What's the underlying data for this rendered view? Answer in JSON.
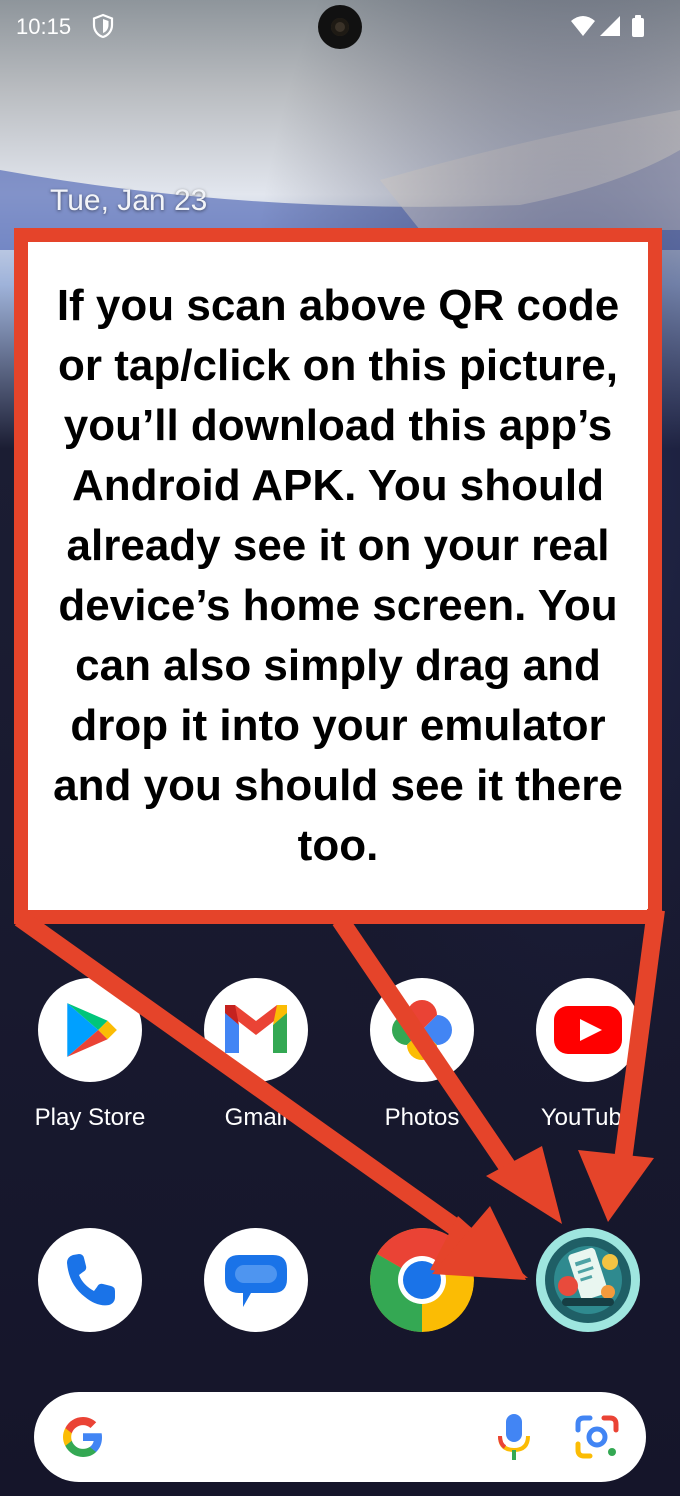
{
  "status_bar": {
    "time": "10:15",
    "icons": [
      "shield-icon",
      "wifi-icon",
      "signal-icon",
      "battery-icon"
    ]
  },
  "home": {
    "date": "Tue, Jan 23"
  },
  "callout": {
    "text": "If you scan above QR code or tap/click on this picture, you’ll download this app’s Android APK. You should already see it on your real device’s home screen. You can also simply drag and drop it into your emulator and you should see it there too.",
    "border_color": "#e5442a"
  },
  "apps_row1": [
    {
      "label": "Play Store",
      "icon": "play-store-icon"
    },
    {
      "label": "Gmail",
      "icon": "gmail-icon"
    },
    {
      "label": "Photos",
      "icon": "photos-icon"
    },
    {
      "label": "YouTube",
      "icon": "youtube-icon"
    }
  ],
  "dock": [
    {
      "icon": "phone-icon"
    },
    {
      "icon": "messages-icon"
    },
    {
      "icon": "chrome-icon"
    },
    {
      "icon": "app-icon"
    }
  ],
  "search_bar": {
    "icons": [
      "google-icon",
      "mic-icon",
      "lens-icon"
    ]
  },
  "colors": {
    "accent": "#e5442a",
    "google_blue": "#4285f4",
    "google_red": "#ea4335",
    "google_yellow": "#fbbc04",
    "google_green": "#34a853"
  }
}
